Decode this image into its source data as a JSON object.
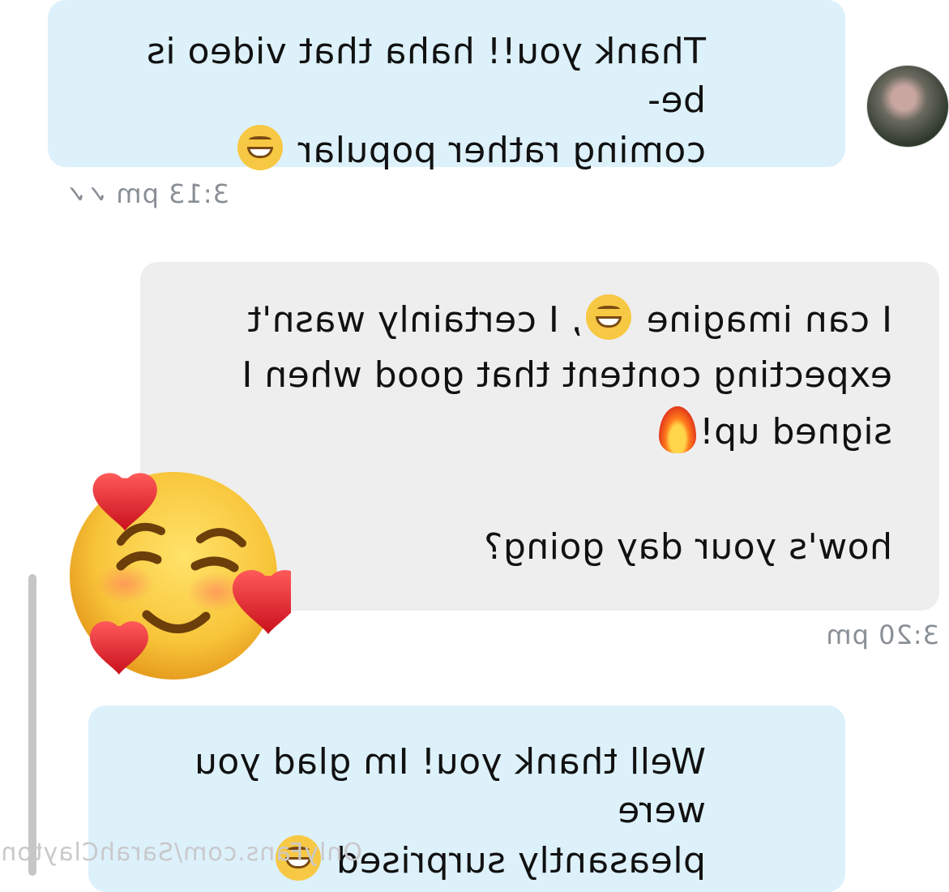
{
  "messages": [
    {
      "direction": "outgoing",
      "text": "Thank you!! haha that video is be-\ncoming rather popular",
      "emoji": "grinning-face",
      "time": "3:13 pm",
      "status": "read"
    },
    {
      "direction": "incoming",
      "text_line1": "I can imagine",
      "text_line1b": ", I certainly wasn't",
      "text_line2": "expecting content that good when I",
      "text_line3": "signed up!",
      "text_line4": "how's your day going?",
      "emoji_1": "tears-of-joy-face",
      "emoji_2": "fire",
      "time": "3:20 pm"
    },
    {
      "direction": "outgoing",
      "text": "Well thank you! Im glad you were\npleasantly surprised",
      "emoji": "grinning-face"
    }
  ],
  "watermark": "OnlyFans.com/SarahClayton",
  "colors": {
    "outgoing_bubble": "#ddf1fb",
    "incoming_bubble": "#eeeeef",
    "timestamp": "#8a8f96"
  }
}
